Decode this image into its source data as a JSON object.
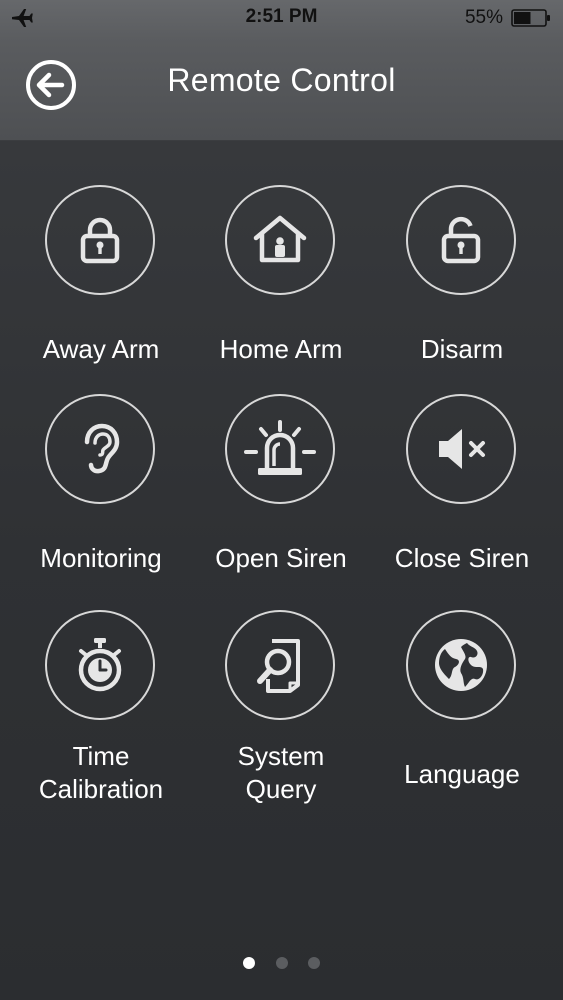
{
  "status_bar": {
    "time": "2:51 PM",
    "battery_percent": "55%",
    "battery_level": 0.55,
    "icons": [
      "airplane-icon",
      "battery-icon"
    ]
  },
  "header": {
    "title": "Remote Control",
    "back_icon": "back-arrow-icon"
  },
  "controls": [
    {
      "label": "Away Arm",
      "icon": "locked-padlock-icon"
    },
    {
      "label": "Home Arm",
      "icon": "home-lock-icon"
    },
    {
      "label": "Disarm",
      "icon": "unlocked-padlock-icon"
    },
    {
      "label": "Monitoring",
      "icon": "ear-icon"
    },
    {
      "label": "Open Siren",
      "icon": "siren-icon"
    },
    {
      "label": "Close Siren",
      "icon": "speaker-mute-icon"
    },
    {
      "label_lines": [
        "Time",
        "Calibration"
      ],
      "icon": "stopwatch-icon"
    },
    {
      "label_lines": [
        "System",
        "Query"
      ],
      "icon": "document-search-icon"
    },
    {
      "label": "Language",
      "icon": "globe-icon"
    }
  ],
  "pagination": {
    "pages": 3,
    "current": 1
  },
  "colors": {
    "background": "#2f3134",
    "header": "#5a5c5f",
    "icon": "#e6e6e6",
    "circle_border": "#d8d8d8",
    "dot_inactive": "#5b5d60",
    "dot_active": "#ffffff"
  }
}
